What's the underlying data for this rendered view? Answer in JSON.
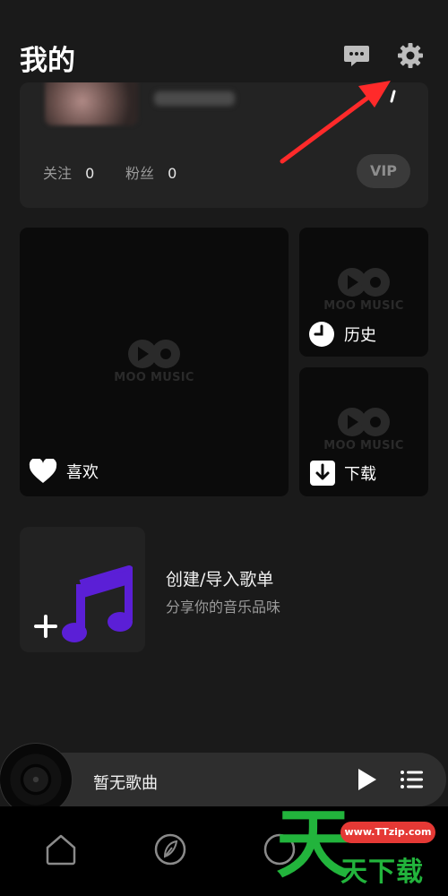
{
  "header": {
    "title": "我的"
  },
  "profile": {
    "follow_label": "关注",
    "follow_count": "0",
    "fans_label": "粉丝",
    "fans_count": "0",
    "vip_label": "VIP"
  },
  "tiles": {
    "favorites_label": "喜欢",
    "history_label": "历史",
    "downloads_label": "下载",
    "placeholder_logo": "MOO MUSIC"
  },
  "create_playlist": {
    "title": "创建/导入歌单",
    "subtitle": "分享你的音乐品味"
  },
  "player": {
    "now_playing": "暂无歌曲"
  },
  "bottom_nav": {
    "items": [
      "home-icon",
      "leaf-icon",
      "circle-icon"
    ]
  },
  "watermark": {
    "url": "www.TTzip.com",
    "big_char": "天",
    "brand": "天下载"
  },
  "colors": {
    "background": "#1a1a1a",
    "card": "#232323",
    "accent_purple": "#5b1fd6",
    "annotation_red": "#ff2a2a"
  },
  "icons": {
    "message": "chat-bubble-icon",
    "settings": "gear-icon",
    "heart": "heart-icon",
    "clock": "clock-icon",
    "download": "download-icon",
    "plus": "plus-icon",
    "music": "music-note-icon",
    "play": "play-icon",
    "queue": "queue-list-icon"
  }
}
